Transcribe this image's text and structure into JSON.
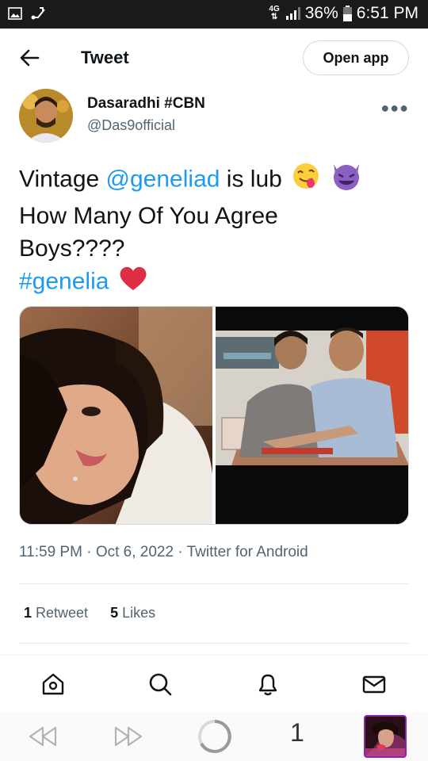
{
  "status_bar": {
    "network": "4G",
    "battery": "36%",
    "time": "6:51 PM",
    "icons": [
      "image-icon",
      "usb-icon",
      "signal-icon",
      "battery-icon"
    ]
  },
  "header": {
    "title": "Tweet",
    "open_app_label": "Open app"
  },
  "author": {
    "name": "Dasaradhi #CBN",
    "handle": "@Das9official"
  },
  "tweet": {
    "part1": "Vintage ",
    "mention": "@geneliad",
    "part2": " is lub",
    "line2": "How Many Of You Agree",
    "line3": "Boys????",
    "hashtag": "#genelia",
    "emojis": [
      "face-savoring-food",
      "smiling-devil",
      "red-heart"
    ]
  },
  "meta": {
    "time": "11:59 PM",
    "date": "Oct 6, 2022",
    "client": "Twitter for Android",
    "separator": " · "
  },
  "stats": {
    "retweets_count": "1",
    "retweets_label": "Retweet",
    "likes_count": "5",
    "likes_label": "Likes"
  },
  "actions": [
    "home-icon",
    "search-icon",
    "bell-icon",
    "mail-icon"
  ],
  "browser": {
    "tab_count": "1",
    "controls": [
      "rewind-icon",
      "fast-forward-icon",
      "loading-icon",
      "profile-thumbnail"
    ]
  },
  "colors": {
    "accent": "#1d9bf0",
    "text": "#0f1419",
    "muted": "#536471",
    "status_bar": "#1a1a1a",
    "profile_border": "#8e24aa"
  }
}
